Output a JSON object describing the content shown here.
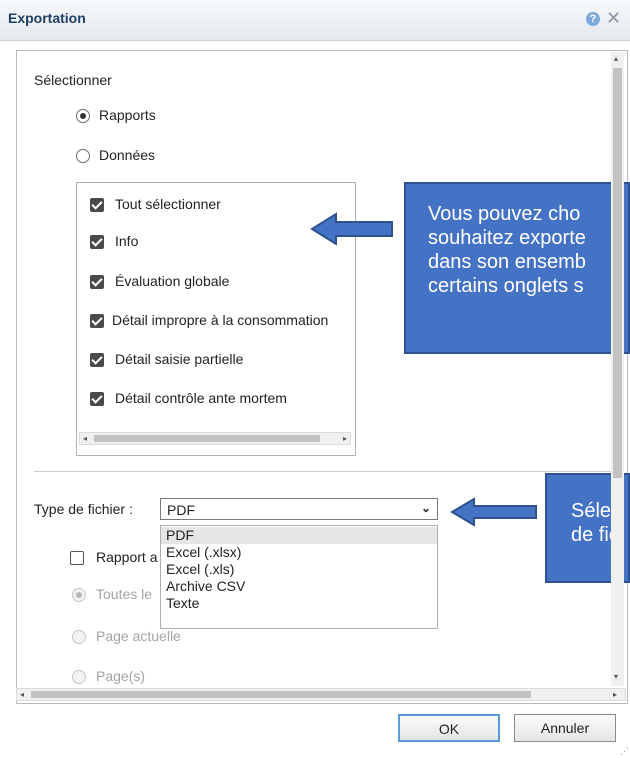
{
  "dialog": {
    "title": "Exportation",
    "help_icon": "question-icon",
    "close_icon": "close-icon"
  },
  "select_section": {
    "label": "Sélectionner",
    "radios": [
      {
        "label": "Rapports",
        "checked": true
      },
      {
        "label": "Données",
        "checked": false
      }
    ],
    "tabs_list": [
      {
        "label": "Tout sélectionner",
        "checked": true
      },
      {
        "label": "Info",
        "checked": true
      },
      {
        "label": "Évaluation globale",
        "checked": true
      },
      {
        "label": "Détail impropre à la consommation",
        "checked": true
      },
      {
        "label": "Détail saisie partielle",
        "checked": true
      },
      {
        "label": "Détail contrôle ante mortem",
        "checked": true
      }
    ]
  },
  "file_type": {
    "label": "Type de fichier :",
    "value": "PDF",
    "options": [
      "PDF",
      "Excel (.xlsx)",
      "Excel (.xls)",
      "Archive CSV",
      "Texte"
    ],
    "selected_index": 0
  },
  "options_section": {
    "checkbox_label": "Rapport a",
    "radios": [
      {
        "label": "Toutes le",
        "checked": true,
        "disabled": true
      },
      {
        "label": "Page actuelle",
        "checked": false,
        "disabled": true
      },
      {
        "label": "Page(s)",
        "checked": false,
        "disabled": true
      }
    ]
  },
  "callouts": {
    "tabs_hint": [
      "Vous pouvez cho",
      "souhaitez exporte",
      "dans son ensemb",
      "certains onglets s"
    ],
    "file_hint": [
      "Sélec",
      "de fic"
    ]
  },
  "buttons": {
    "ok": "OK",
    "cancel": "Annuler"
  },
  "colors": {
    "callout_fill": "#4472c4",
    "callout_border": "#2f528f",
    "arrow_fill": "#4472c4",
    "title_text": "#1f3f66"
  }
}
